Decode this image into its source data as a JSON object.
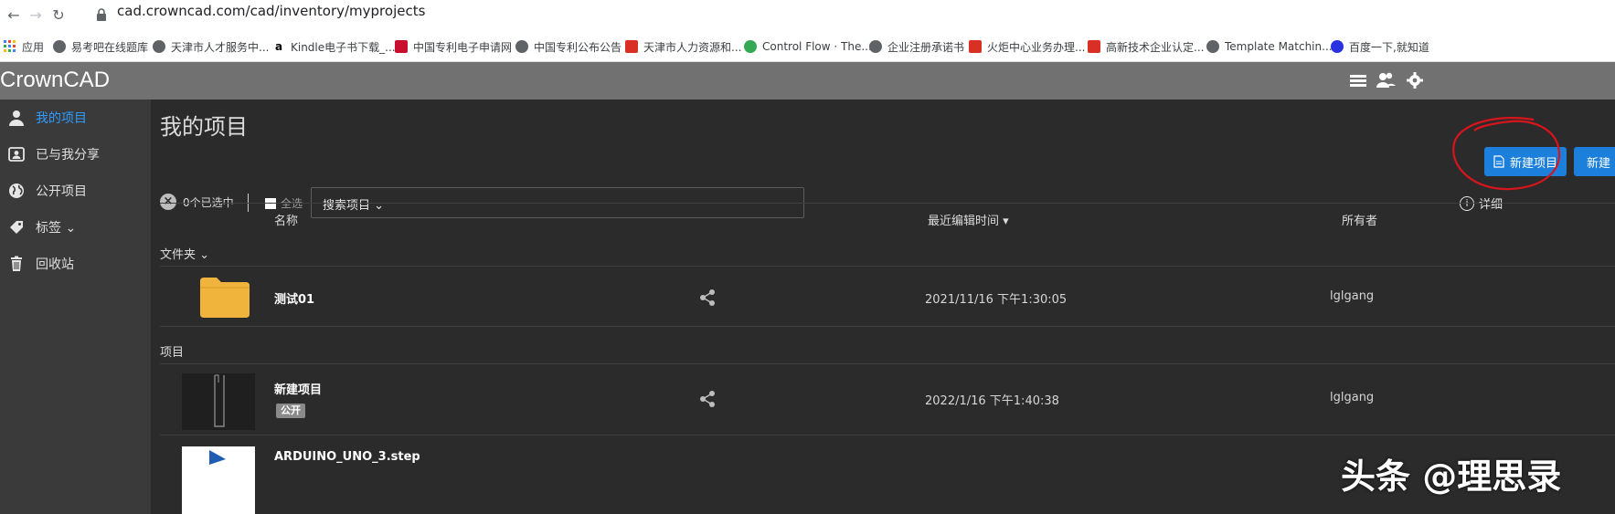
{
  "browser": {
    "url": "cad.crowncad.com/cad/inventory/myprojects",
    "back_label": "←",
    "forward_label": "→",
    "reload_label": "↻"
  },
  "bookmarks": {
    "items": [
      {
        "label": "应用",
        "color": "#4285f4"
      },
      {
        "label": "易考吧在线题库",
        "color": "#5f6368"
      },
      {
        "label": "天津市人才服务中...",
        "color": "#5f6368"
      },
      {
        "label": "Kindle电子书下载_...",
        "color": "#ff9900"
      },
      {
        "label": "中国专利电子申请网",
        "color": "#c8102e"
      },
      {
        "label": "中国专利公布公告",
        "color": "#5f6368"
      },
      {
        "label": "天津市人力资源和...",
        "color": "#d93025"
      },
      {
        "label": "Control Flow · The...",
        "color": "#34a853"
      },
      {
        "label": "企业注册承诺书",
        "color": "#5f6368"
      },
      {
        "label": "火炬中心业务办理...",
        "color": "#d93025"
      },
      {
        "label": "高新技术企业认定...",
        "color": "#d93025"
      },
      {
        "label": "Template Matchin...",
        "color": "#5f6368"
      },
      {
        "label": "百度一下,就知道",
        "color": "#2932e1"
      }
    ]
  },
  "header": {
    "logo": "CrownCAD",
    "icons": [
      "list-icon",
      "users-icon",
      "gear-icon"
    ]
  },
  "sidebar": {
    "items": [
      {
        "label": "我的项目",
        "icon": "user-icon",
        "active": true
      },
      {
        "label": "已与我分享",
        "icon": "shared-contact-icon",
        "active": false
      },
      {
        "label": "公开项目",
        "icon": "globe-icon",
        "active": false
      },
      {
        "label": "标签 ⌄",
        "icon": "tag-icon",
        "active": false
      },
      {
        "label": "回收站",
        "icon": "trash-icon",
        "active": false
      }
    ]
  },
  "main": {
    "title": "我的项目",
    "new_project_button": "新建项目",
    "new_button_2": "新建",
    "selected_count": "0个已选中",
    "select_all": "全选",
    "search_dropdown": "搜索项目 ⌄",
    "details": "详细",
    "columns": {
      "name": "名称",
      "last_edited": "最近编辑时间 ▾",
      "owner": "所有者"
    },
    "sections": {
      "folders": "文件夹 ⌄",
      "projects": "项目"
    },
    "folder_rows": [
      {
        "name": "测试01",
        "date": "2021/11/16 下午1:30:05",
        "owner": "lglgang"
      }
    ],
    "project_rows": [
      {
        "name": "新建项目",
        "badge": "公开",
        "date": "2022/1/16 下午1:40:38",
        "owner": "lglgang"
      },
      {
        "name": "ARDUINO_UNO_3.step"
      }
    ]
  },
  "watermark": "头条 @理思录",
  "colors": {
    "accent": "#1b7fdb",
    "active_link": "#2e9bff",
    "folder": "#f0b43c",
    "annotation": "#d8141c"
  }
}
